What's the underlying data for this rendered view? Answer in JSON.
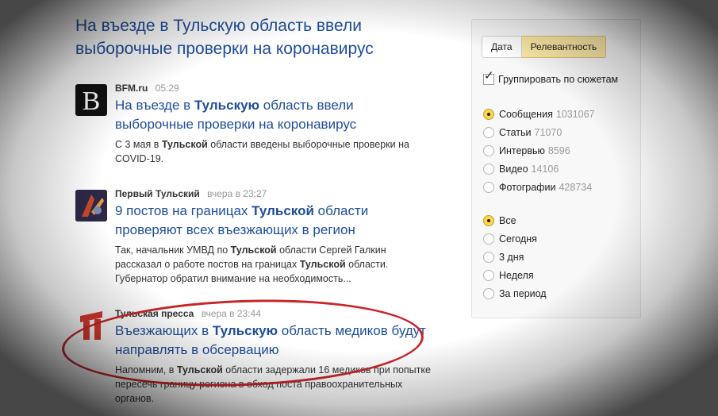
{
  "page_title": "На въезде в Тульскую область ввели выборочные проверки на коронавирус",
  "news": [
    {
      "source": "BFM.ru",
      "time": "05:29",
      "logo": "bfm-logo",
      "headline": [
        {
          "text": "На въезде в ",
          "bold": false
        },
        {
          "text": "Тульскую",
          "bold": true
        },
        {
          "text": " область ввели выборочные проверки на коронавирус",
          "bold": false
        }
      ],
      "snippet": [
        {
          "text": "С 3 мая в ",
          "bold": false
        },
        {
          "text": "Тульской",
          "bold": true
        },
        {
          "text": " области введены выборочные проверки на COVID-19.",
          "bold": false
        }
      ]
    },
    {
      "source": "Первый Тульский",
      "time": "вчера в 23:27",
      "logo": "pervy-tulsky-logo",
      "headline": [
        {
          "text": "9 постов на границах ",
          "bold": false
        },
        {
          "text": "Тульской",
          "bold": true
        },
        {
          "text": " области проверяют всех въезжающих в регион",
          "bold": false
        }
      ],
      "snippet": [
        {
          "text": "Так, начальник УМВД по ",
          "bold": false
        },
        {
          "text": "Тульской",
          "bold": true
        },
        {
          "text": " области Сергей Галкин рассказал о работе постов на границах ",
          "bold": false
        },
        {
          "text": "Тульской",
          "bold": true
        },
        {
          "text": " области. Губернатор обратил внимание на необходимость...",
          "bold": false
        }
      ]
    },
    {
      "source": "Тульская пресса",
      "time": "вчера в 23:44",
      "logo": "tulskaya-pressa-logo",
      "headline": [
        {
          "text": "Въезжающих в ",
          "bold": false
        },
        {
          "text": "Тульскую",
          "bold": true
        },
        {
          "text": " область медиков будут направлять в обсервацию",
          "bold": false
        }
      ],
      "snippet": [
        {
          "text": "Напомним, в ",
          "bold": false
        },
        {
          "text": "Тульской",
          "bold": true
        },
        {
          "text": " области задержали 16 медиков при попытке пересечь границу региона в обход поста правоохранительных органов.",
          "bold": false
        }
      ]
    }
  ],
  "filters": {
    "sort_options": [
      {
        "label": "Дата",
        "active": false
      },
      {
        "label": "Релевантность",
        "active": true
      }
    ],
    "group_by_stories": {
      "label": "Группировать по сюжетам",
      "checked": true
    },
    "content_types": [
      {
        "label": "Сообщения",
        "count": "1031067",
        "checked": true
      },
      {
        "label": "Статьи",
        "count": "71070",
        "checked": false
      },
      {
        "label": "Интервью",
        "count": "8596",
        "checked": false
      },
      {
        "label": "Видео",
        "count": "14106",
        "checked": false
      },
      {
        "label": "Фотографии",
        "count": "428734",
        "checked": false
      }
    ],
    "periods": [
      {
        "label": "Все",
        "checked": true
      },
      {
        "label": "Сегодня",
        "checked": false
      },
      {
        "label": "3 дня",
        "checked": false
      },
      {
        "label": "Неделя",
        "checked": false
      },
      {
        "label": "За период",
        "checked": false
      }
    ]
  },
  "colors": {
    "link": "#1f4e9a",
    "accent_yellow": "#fcd74a",
    "annotation_red": "#c8262a"
  }
}
